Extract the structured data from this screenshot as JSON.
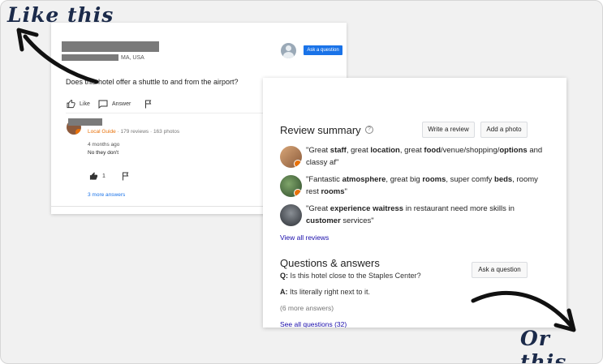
{
  "annotations": {
    "top_left": "Like this",
    "bottom_right": "Or this"
  },
  "qa_card": {
    "location": "MA, USA",
    "ask_button": "Ask a question",
    "question": "Does this hotel offer a shuttle to and from the airport?",
    "like_label": "Like",
    "answer_label": "Answer",
    "local_guide": "Local Guide",
    "guide_stats": " · 179 reviews · 163 photos",
    "time_ago": "4 months ago",
    "answer_text": "No they don't",
    "like_count": "1",
    "more_answers": "3 more answers"
  },
  "review_card": {
    "title": "Review summary",
    "help_icon": "?",
    "write_review": "Write a review",
    "add_photo": "Add a photo",
    "reviews": [
      {
        "parts": [
          {
            "t": "\"Great "
          },
          {
            "t": "staff",
            "b": true
          },
          {
            "t": ", great "
          },
          {
            "t": "location",
            "b": true
          },
          {
            "t": ", great "
          },
          {
            "t": "food",
            "b": true
          },
          {
            "t": "/venue/shopping/"
          },
          {
            "t": "options",
            "b": true
          },
          {
            "t": " and classy af\""
          }
        ]
      },
      {
        "parts": [
          {
            "t": "\"Fantastic "
          },
          {
            "t": "atmosphere",
            "b": true
          },
          {
            "t": ", great big "
          },
          {
            "t": "rooms",
            "b": true
          },
          {
            "t": ", super comfy "
          },
          {
            "t": "beds",
            "b": true
          },
          {
            "t": ", roomy rest "
          },
          {
            "t": "rooms",
            "b": true
          },
          {
            "t": "\""
          }
        ]
      },
      {
        "parts": [
          {
            "t": "\"Great "
          },
          {
            "t": "experience waitress",
            "b": true
          },
          {
            "t": " in restaurant need more skills in "
          },
          {
            "t": "customer",
            "b": true
          },
          {
            "t": " services\""
          }
        ]
      }
    ],
    "view_all_reviews": "View all reviews",
    "qa_title": "Questions & answers",
    "ask_question": "Ask a question",
    "q_prefix": "Q:",
    "q_text": " Is this hotel close to the Staples Center?",
    "a_prefix": "A:",
    "a_text": " Its literally right next to it.",
    "more_answers": "(6 more answers)",
    "see_all": "See all questions (32)"
  },
  "colors": {
    "accent_blue": "#1a73e8",
    "link_blue": "#1a0dab",
    "local_guide_orange": "#e8710a",
    "annotation_navy": "#1b2a4a"
  }
}
